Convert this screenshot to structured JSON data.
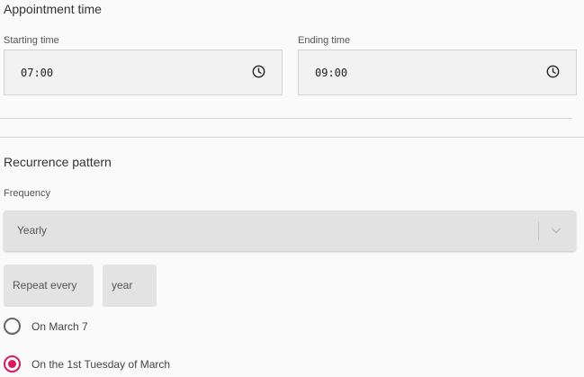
{
  "appointment": {
    "title": "Appointment time",
    "start": {
      "label": "Starting time",
      "value": "07:00",
      "icon": "clock-icon"
    },
    "end": {
      "label": "Ending time",
      "value": "09:00",
      "icon": "clock-icon"
    }
  },
  "recurrence": {
    "title": "Recurrence pattern",
    "frequency": {
      "label": "Frequency",
      "selected": "Yearly",
      "icon": "chevron-down-icon"
    },
    "repeat": {
      "label": "Repeat every",
      "unit": "year"
    },
    "options": [
      {
        "label": "On March 7",
        "selected": false
      },
      {
        "label": "On the 1st Tuesday of March",
        "selected": true
      }
    ]
  },
  "colors": {
    "accent": "#d81b60",
    "background": "#fafafa",
    "field_background": "#f2f2f2",
    "select_background": "#e2e2e2"
  }
}
